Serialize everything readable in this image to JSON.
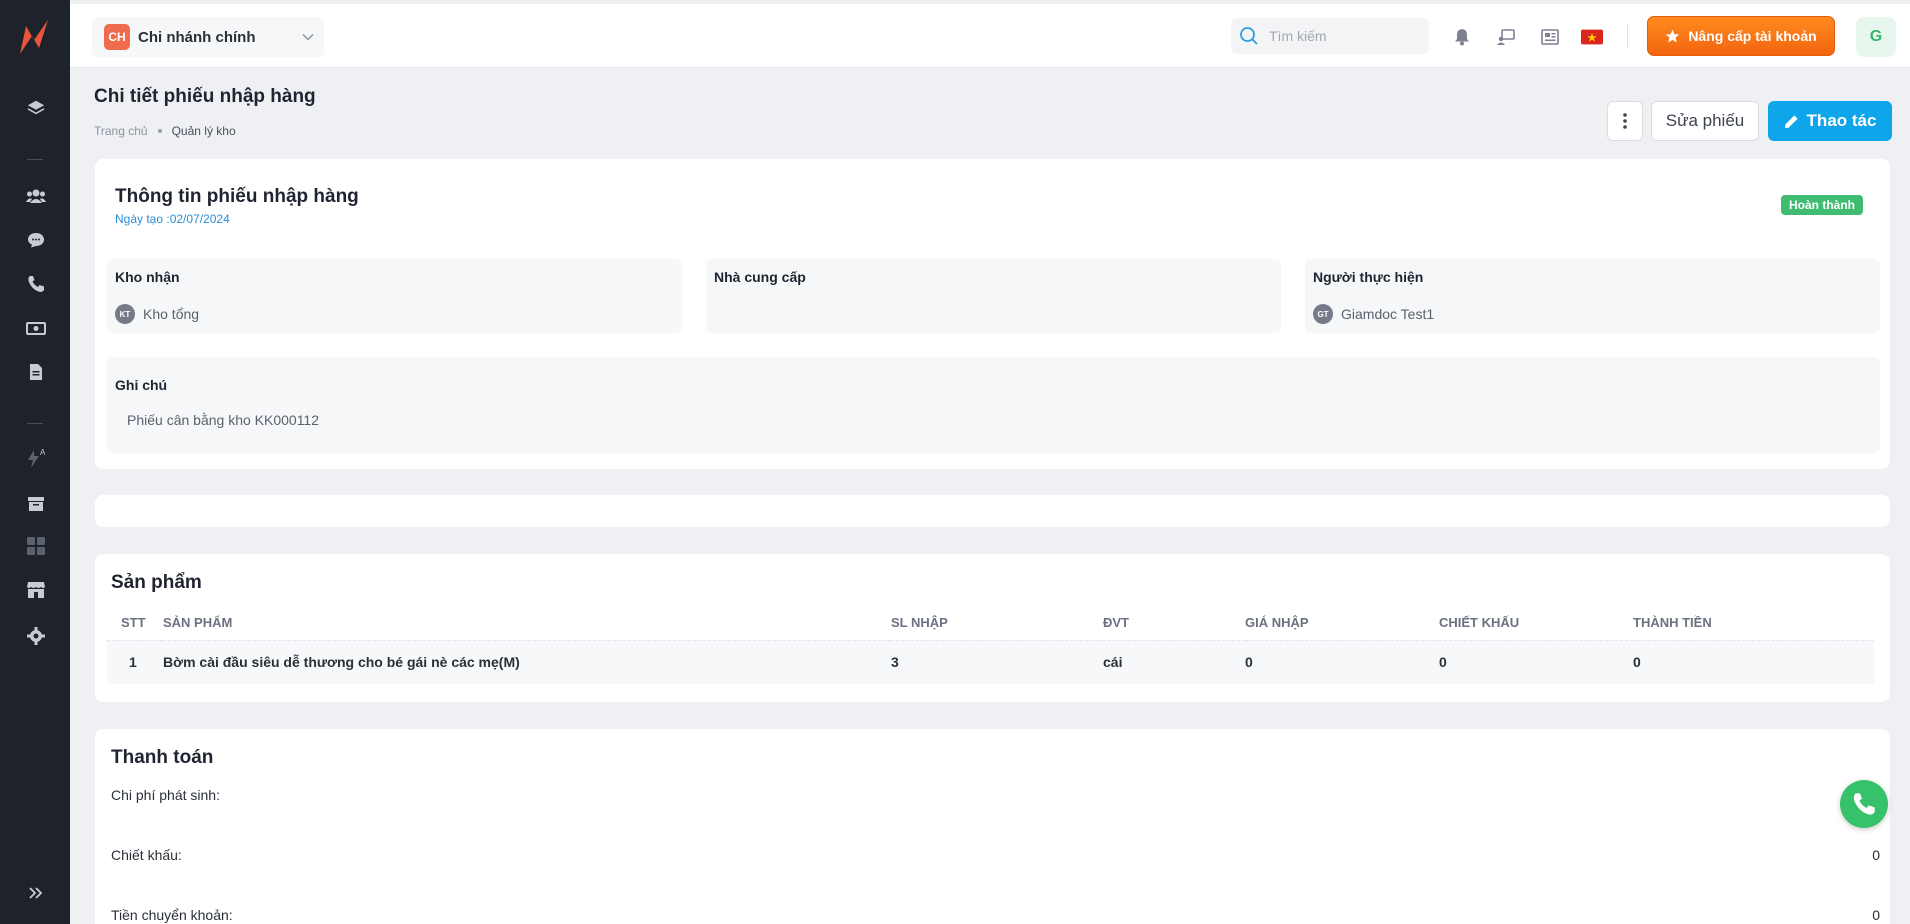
{
  "branch": {
    "initials": "CH",
    "name": "Chi nhánh chính"
  },
  "search": {
    "placeholder": "Tìm kiếm"
  },
  "header": {
    "upgrade_label": "Nâng cấp tài khoản",
    "user_initial": "G"
  },
  "page": {
    "title": "Chi tiết phiếu nhập hàng",
    "breadcrumbs": [
      "Trang chủ",
      "Quản lý kho"
    ],
    "edit_label": "Sửa phiếu",
    "action_label": "Thao tác"
  },
  "info": {
    "title": "Thông tin phiếu nhập hàng",
    "date": "Ngày tạo :02/07/2024",
    "status": "Hoàn thành",
    "warehouse_label": "Kho nhận",
    "warehouse_initials": "KT",
    "warehouse_value": "Kho tổng",
    "supplier_label": "Nhà cung cấp",
    "performer_label": "Người thực hiện",
    "performer_initials": "GT",
    "performer_value": "Giamdoc Test1",
    "note_label": "Ghi chú",
    "note_value": "Phiếu cân bằng kho KK000112"
  },
  "products": {
    "title": "Sản phẩm",
    "columns": [
      "STT",
      "SẢN PHẨM",
      "SL NHẬP",
      "ĐVT",
      "GIÁ NHẬP",
      "CHIẾT KHẤU",
      "THÀNH TIỀN"
    ],
    "rows": [
      [
        "1",
        "Bờm cài đầu siêu dễ thương cho bé gái nè các mẹ(M)",
        "3",
        "cái",
        "0",
        "0",
        "0"
      ]
    ]
  },
  "payment": {
    "title": "Thanh toán",
    "rows": [
      {
        "label": "Chi phí phát sinh:",
        "value": ""
      },
      {
        "label": "Chiết khấu:",
        "value": "0"
      },
      {
        "label": "Tiền chuyển khoản:",
        "value": "0"
      }
    ]
  },
  "colors": {
    "primary": "#0ea5ea",
    "upgrade": "#f97316",
    "success": "#3fbb72",
    "sidebar": "#1e232b"
  }
}
